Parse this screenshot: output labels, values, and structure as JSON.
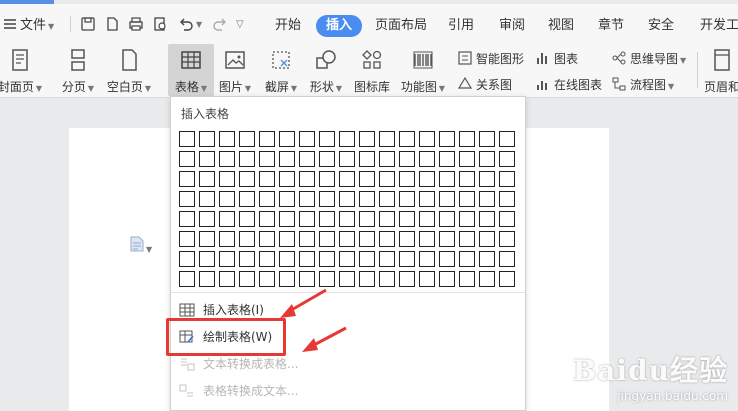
{
  "menubar": {
    "file_label": "文件",
    "tabs": [
      "开始",
      "插入",
      "页面布局",
      "引用",
      "审阅",
      "视图",
      "章节",
      "安全",
      "开发工"
    ],
    "active_tab": "插入"
  },
  "ribbon": {
    "buttons": [
      "封面页",
      "分页",
      "空白页",
      "表格",
      "图片",
      "截屏",
      "形状",
      "图标库",
      "功能图",
      "页眉和"
    ],
    "small": [
      "智能图形",
      "图表",
      "思维导图",
      "关系图",
      "在线图表",
      "流程图"
    ]
  },
  "dropdown": {
    "title": "插入表格",
    "rows": 8,
    "cols": 17,
    "items": [
      "插入表格(I)",
      "绘制表格(W)",
      "文本转换成表格...",
      "表格转换成文本..."
    ]
  },
  "watermark": {
    "brand": "Baidu经验",
    "url": "jingyan.baidu.com"
  },
  "colors": {
    "active_tab": "#4a8cf0",
    "highlight": "#e53935"
  }
}
